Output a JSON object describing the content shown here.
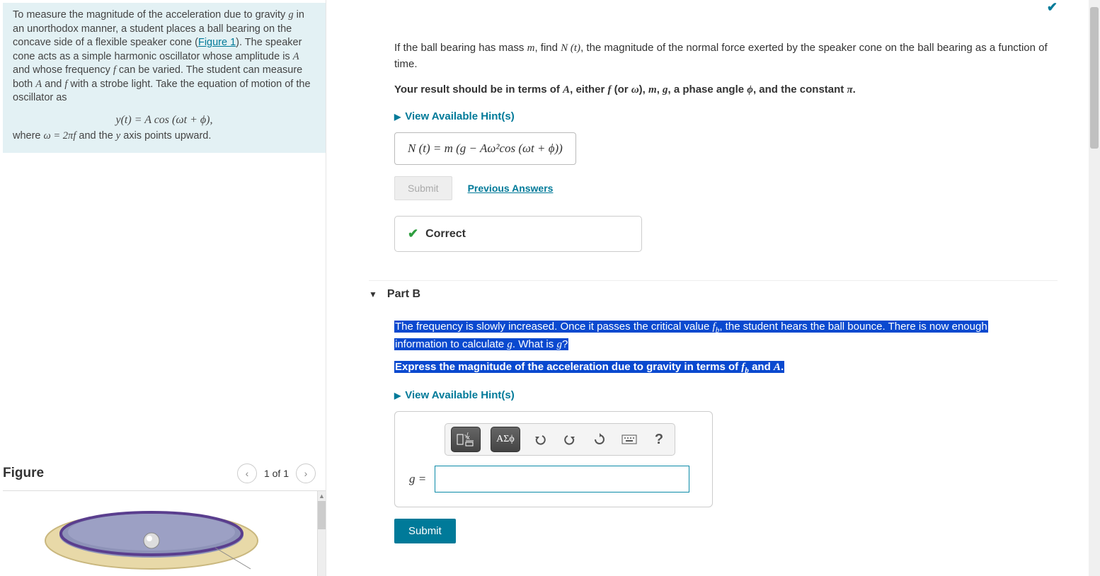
{
  "left": {
    "intro_1": "To measure the magnitude of the acceleration due to gravity ",
    "intro_2": " in an unorthodox manner, a student places a ball bearing on the concave side of a flexible speaker cone (",
    "figure_link": "Figure 1",
    "intro_3": "). The speaker cone acts as a simple harmonic oscillator whose amplitude is ",
    "intro_4": " and whose frequency ",
    "intro_5": " can be varied. The student can measure both ",
    "intro_6": " and ",
    "intro_7": " with a strobe light. Take the equation of motion of the oscillator as",
    "equation": "y(t) = A cos (ωt + ϕ),",
    "where_1": "where ",
    "where_2": " and the ",
    "where_3": " axis points upward.",
    "omega_eq": "ω = 2πf",
    "figure_title": "Figure",
    "figure_pager": "1 of 1"
  },
  "partA": {
    "q1": "If the ball bearing has mass ",
    "q2": ", find ",
    "q3": ", the magnitude of the normal force exerted by the speaker cone on the ball bearing as a function of time.",
    "instr1": "Your result should be in terms of ",
    "instr2": ", either ",
    "instr3": " (or ",
    "instr4": "), ",
    "instr5": ", ",
    "instr6": ", a phase angle ",
    "instr7": ", and the constant ",
    "instr8": ".",
    "hints": "View Available Hint(s)",
    "answer": "N (t) =  m (g − Aω²cos (ωt + ϕ))",
    "submit": "Submit",
    "previous": "Previous Answers",
    "correct": "Correct"
  },
  "partB": {
    "title": "Part B",
    "q1a": "The frequency is slowly increased. Once it passes the critical value ",
    "q1b": ", the student hears the ball bounce. There is now enough",
    "q1c": "information to calculate ",
    "q1d": ". What is ",
    "q1e": "?",
    "instr1": "Express the magnitude of the acceleration due to gravity in terms of ",
    "instr2": " and ",
    "instr3": ".",
    "hints": "View Available Hint(s)",
    "greek": "ΑΣϕ",
    "help": "?",
    "label": "g =",
    "submit": "Submit"
  }
}
